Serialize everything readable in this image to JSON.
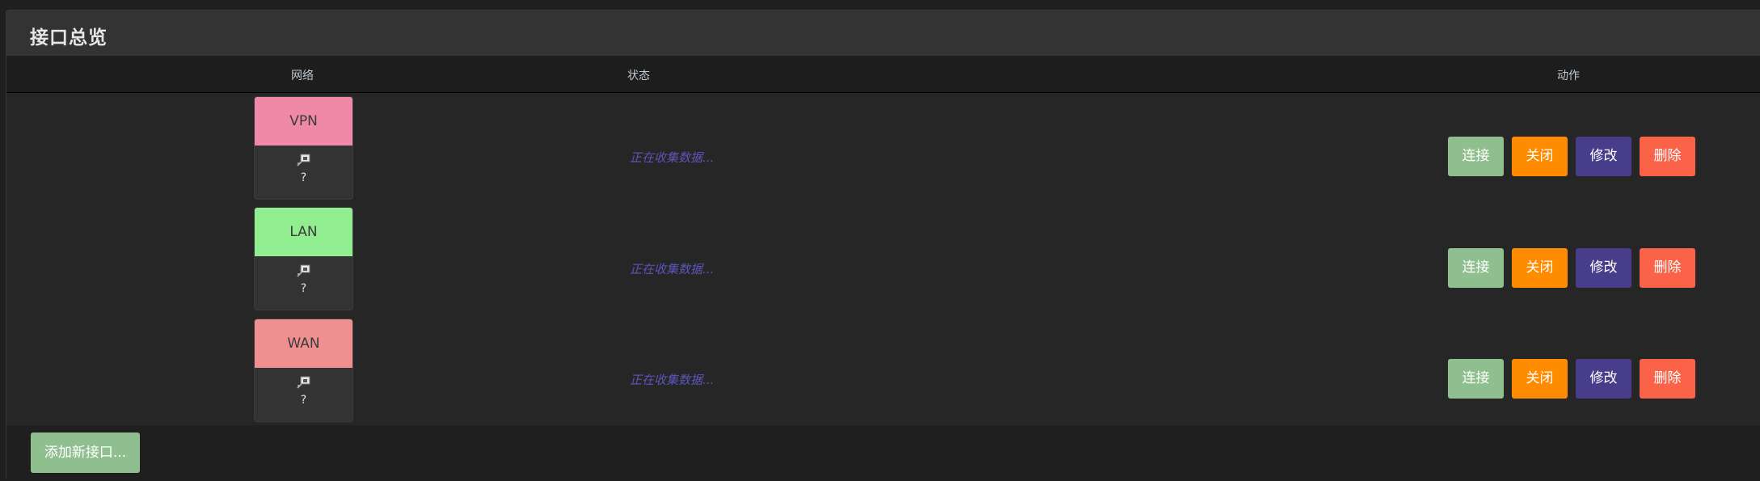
{
  "panel": {
    "title": "接口总览"
  },
  "table": {
    "headers": {
      "network": "网络",
      "status": "状态",
      "actions": "动作"
    }
  },
  "rows": [
    {
      "name": "VPN",
      "color": "#f089a8",
      "question": "?",
      "status": "正在收集数据...",
      "connect": "连接",
      "close": "关闭",
      "edit": "修改",
      "delete": "删除"
    },
    {
      "name": "LAN",
      "color": "#90ee90",
      "question": "?",
      "status": "正在收集数据...",
      "connect": "连接",
      "close": "关闭",
      "edit": "修改",
      "delete": "删除"
    },
    {
      "name": "WAN",
      "color": "#f08f8f",
      "question": "?",
      "status": "正在收集数据...",
      "connect": "连接",
      "close": "关闭",
      "edit": "修改",
      "delete": "删除"
    }
  ],
  "footer": {
    "add_label": "添加新接口..."
  },
  "colors": {
    "connect": "#8fbf8f",
    "close": "#ff8c00",
    "edit": "#483d8b",
    "delete": "#fa6347",
    "status_text": "#5e55b8"
  }
}
